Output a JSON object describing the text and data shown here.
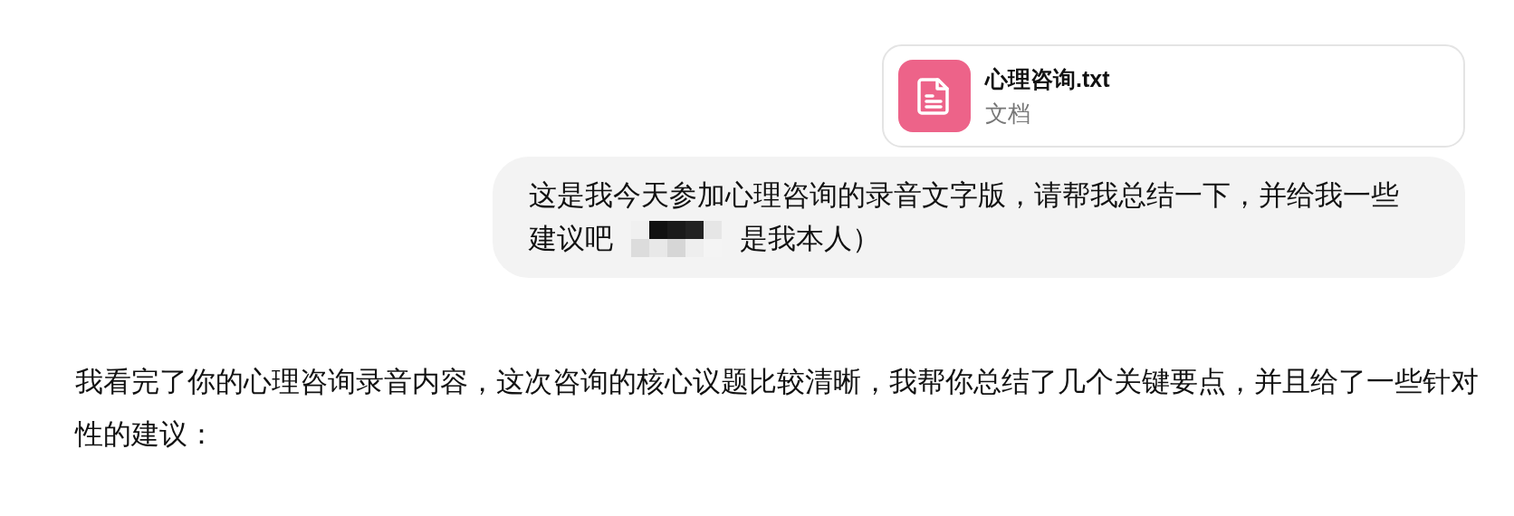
{
  "user_message": {
    "attachment": {
      "file_name": "心理咨询.txt",
      "file_type": "文档"
    },
    "line_1": "这是我今天参加心理咨询的录音文字版，请帮我总结一下，并给我一些",
    "line_2_before": "建议吧",
    "line_2_after": "是我本人）"
  },
  "assistant_message": {
    "text": "我看完了你的心理咨询录音内容，这次咨询的核心议题比较清晰，我帮你总结了几个关键要点，并且给了一些针对性的建议："
  }
}
